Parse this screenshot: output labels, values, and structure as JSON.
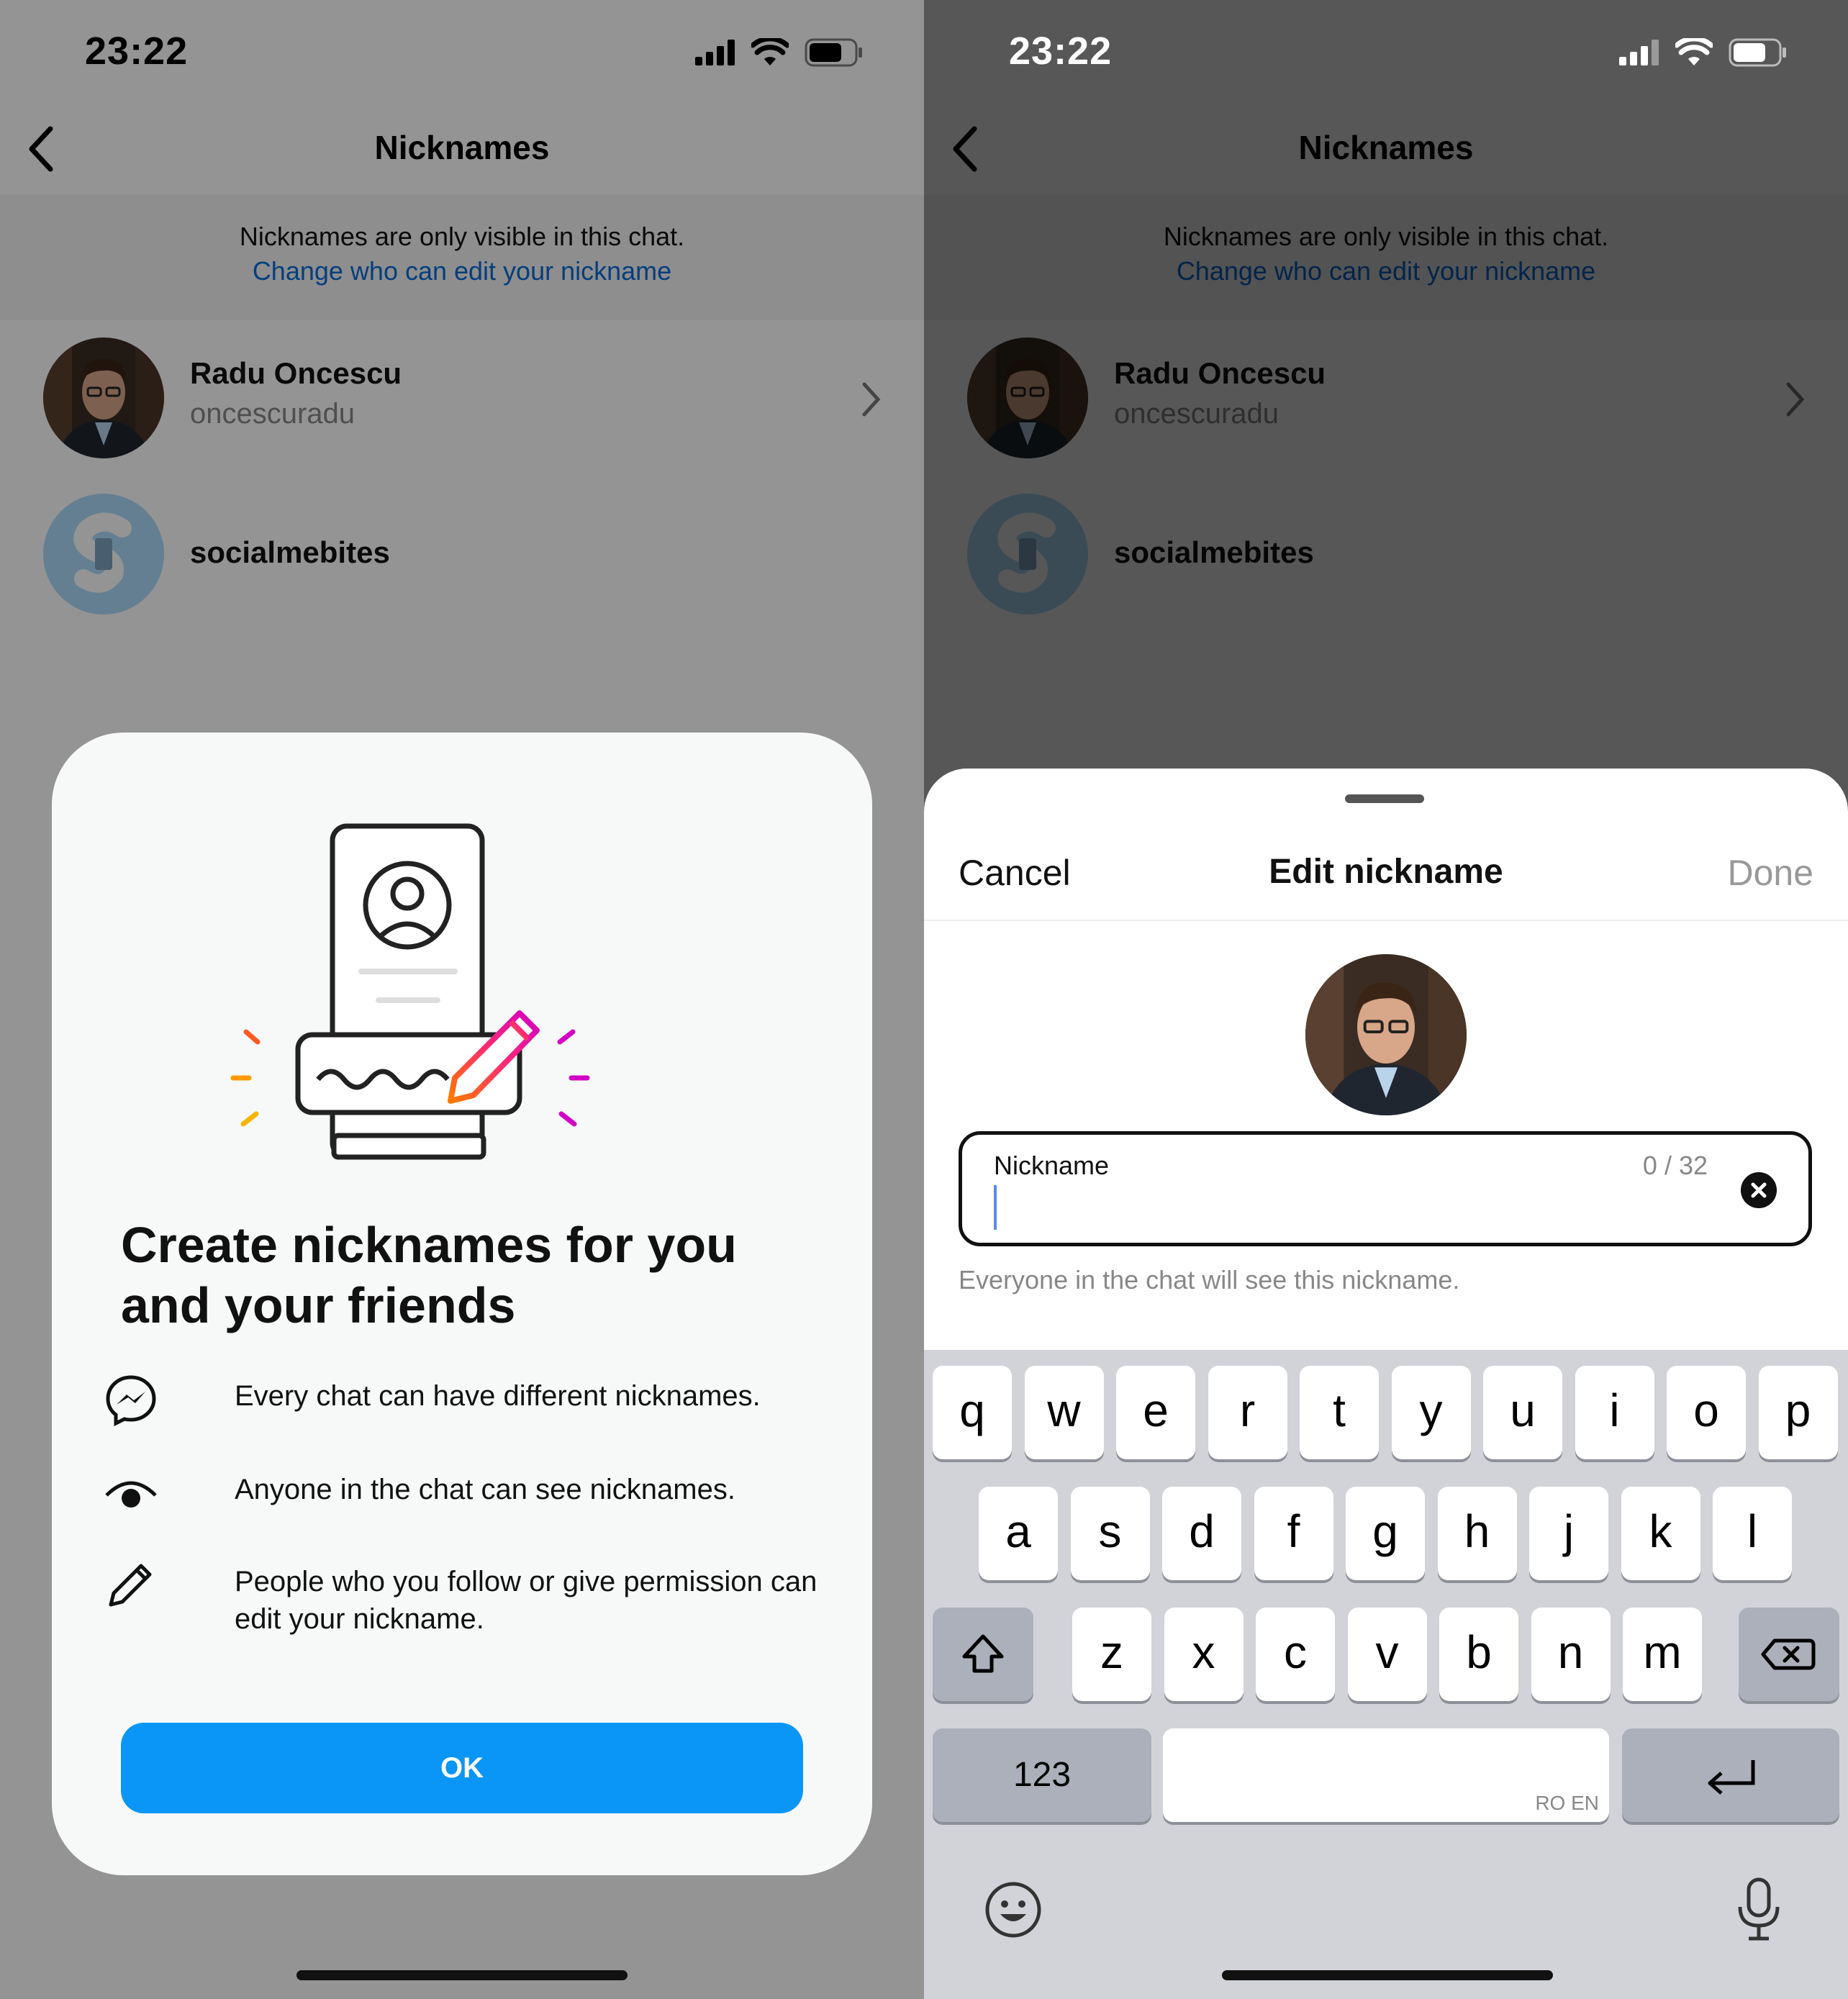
{
  "status_bar": {
    "time": "23:22"
  },
  "header": {
    "title": "Nicknames"
  },
  "info": {
    "text": "Nicknames are only visible in this chat.",
    "link": "Change who can edit your nickname"
  },
  "participants": [
    {
      "name": "Radu Oncescu",
      "username": "oncescuradu"
    },
    {
      "name": "socialmebites",
      "username": ""
    }
  ],
  "intro_modal": {
    "title": "Create nicknames for you and your friends",
    "features": [
      {
        "icon": "messenger-icon",
        "text": "Every chat can have different nicknames."
      },
      {
        "icon": "eye-icon",
        "text": "Anyone in the chat can see nicknames."
      },
      {
        "icon": "pencil-icon",
        "text": "People who you follow or give permission can edit your nickname."
      }
    ],
    "ok_label": "OK"
  },
  "edit_sheet": {
    "cancel_label": "Cancel",
    "title": "Edit nickname",
    "done_label": "Done",
    "field_label": "Nickname",
    "value": "",
    "counter": "0 / 32",
    "helper": "Everyone in the chat will see this nickname."
  },
  "keyboard": {
    "row1": [
      "q",
      "w",
      "e",
      "r",
      "t",
      "y",
      "u",
      "i",
      "o",
      "p"
    ],
    "row2": [
      "a",
      "s",
      "d",
      "f",
      "g",
      "h",
      "j",
      "k",
      "l"
    ],
    "row3": [
      "z",
      "x",
      "c",
      "v",
      "b",
      "n",
      "m"
    ],
    "numbers_label": "123",
    "space_hint": "RO EN"
  },
  "colors": {
    "link": "#0a6bd8",
    "ok_button": "#0a96f6",
    "caret": "#5b8af6",
    "gradient_start": "#f8b500",
    "gradient_end": "#d300c5"
  }
}
